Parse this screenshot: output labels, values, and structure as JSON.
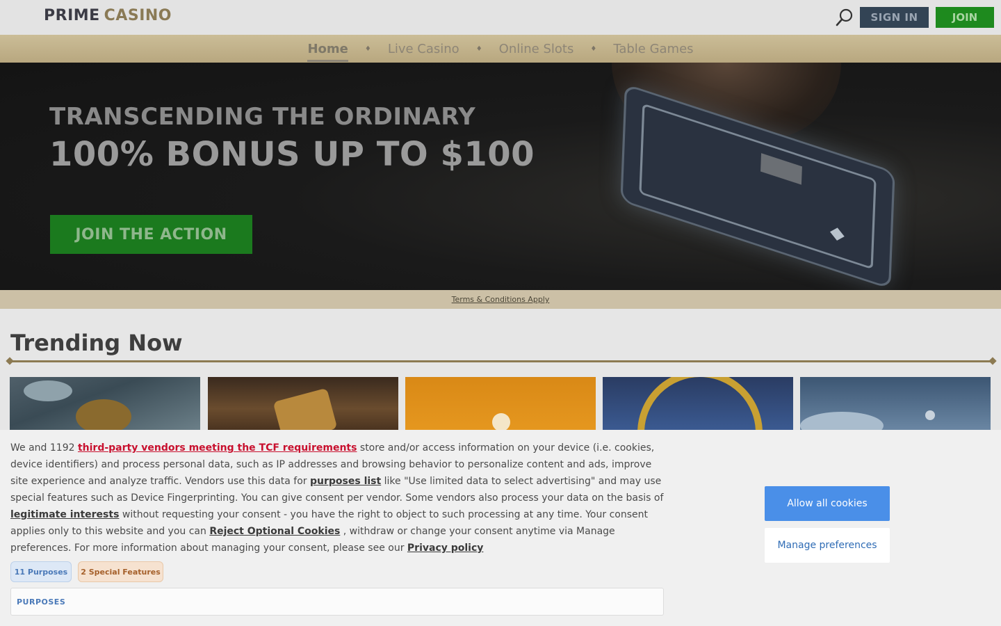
{
  "header": {
    "logo_part1": "PRIME",
    "logo_part2": "CASINO",
    "search_icon": "search-icon",
    "sign_in_label": "SIGN IN",
    "join_label": "JOIN"
  },
  "nav": {
    "items": [
      {
        "label": "Home",
        "active": true
      },
      {
        "label": "Live Casino",
        "active": false
      },
      {
        "label": "Online Slots",
        "active": false
      },
      {
        "label": "Table Games",
        "active": false
      }
    ],
    "separator": "♦"
  },
  "hero": {
    "subtitle": "TRANSCENDING THE ORDINARY",
    "title": "100% BONUS UP TO $100",
    "cta_label": "JOIN THE ACTION",
    "terms_link": "Terms & Conditions Apply"
  },
  "trending": {
    "title": "Trending Now",
    "tiles_count_visible": 5
  },
  "consent": {
    "text_1": "We and 1192 ",
    "link_vendors": "third-party vendors meeting the TCF requirements",
    "text_2": " store and/or access information on your device (i.e. cookies, device identifiers) and process personal data, such as IP addresses and browsing behavior to personalize content and ads, improve site experience and analyze traffic. Vendors use this data for ",
    "link_purposes": "purposes list",
    "text_3": "  like \"Use limited data to select advertising\" and may use special features such as Device Fingerprinting. You can give consent per vendor. Some vendors also process your data on the basis of ",
    "link_legit": "legitimate interests",
    "text_4": "  without requesting your consent - you have the right to object to such processing at any time. Your consent applies only to this website and you can ",
    "link_reject": "Reject Optional Cookies",
    "text_5": " , withdraw or change your consent anytime via Manage preferences. For more information about managing your consent, please see our ",
    "link_privacy": "Privacy policy",
    "pill_purposes": "11 Purposes",
    "pill_special": "2 Special Features",
    "purposes_header": "PURPOSES",
    "allow_label": "Allow all cookies",
    "manage_label": "Manage preferences"
  },
  "colors": {
    "join_green": "#1e8a1e",
    "signin_navy": "#334455",
    "nav_gold": "#c2b38c",
    "allow_blue": "#4a8fe8",
    "vendor_link_red": "#c8102e"
  }
}
